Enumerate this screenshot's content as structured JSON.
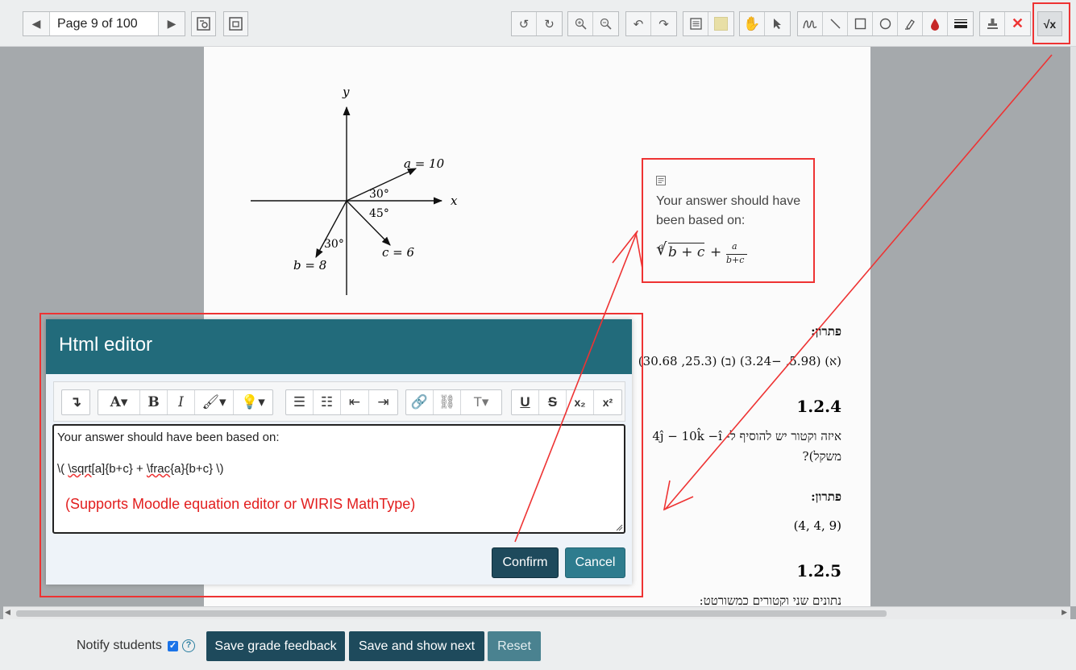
{
  "toolbar": {
    "page_label": "Page 9 of 100",
    "sqrt_label": "√x"
  },
  "document": {
    "axis_y": "y",
    "axis_x": "x",
    "vec_a": "a = 10",
    "vec_b": "b = 8",
    "vec_c": "c = 6",
    "angle1": "30°",
    "angle2": "45°",
    "angle3": "30°",
    "solution_label1": "פתרון:",
    "answer_line": "(א) (5.98, −3.24) (ב) (25.3, 30.68)",
    "section1": "1.2.4",
    "question_line1": "איזה וקטור יש להוסיף ל- 4ĵ − 10k̂ −î",
    "question_line2": "משקל)?",
    "solution_label2": "פתרון:",
    "answer2": "(4, 4, 9)",
    "section2": "1.2.5",
    "question2": "נתונים שני וקטורים כמשורטט:"
  },
  "comment": {
    "text": "Your answer should have been based on:",
    "formula_index": "a",
    "formula_radicand": "b + c",
    "formula_plus": "+",
    "formula_num": "a",
    "formula_den": "b+c"
  },
  "dialog": {
    "title": "Html editor",
    "line1": "Your answer should have been based on:",
    "latex_pre": "\\( ",
    "latex_sqrt": "\\sqrt",
    "latex_mid": "[a]{b+c} + ",
    "latex_frac": "\\frac",
    "latex_post": "{a}{b+c} \\)",
    "note": "(Supports Moodle equation editor or WIRIS MathType)",
    "confirm": "Confirm",
    "cancel": "Cancel"
  },
  "bottom": {
    "notify_label": "Notify students",
    "notify_checked": true,
    "save_feedback": "Save grade feedback",
    "save_next": "Save and show next",
    "reset": "Reset"
  },
  "colors": {
    "dialog_header": "#226b7b",
    "annotation_red": "#e33333",
    "primary_button": "#1e4a5c",
    "cancel_button": "#2e7c8e"
  }
}
